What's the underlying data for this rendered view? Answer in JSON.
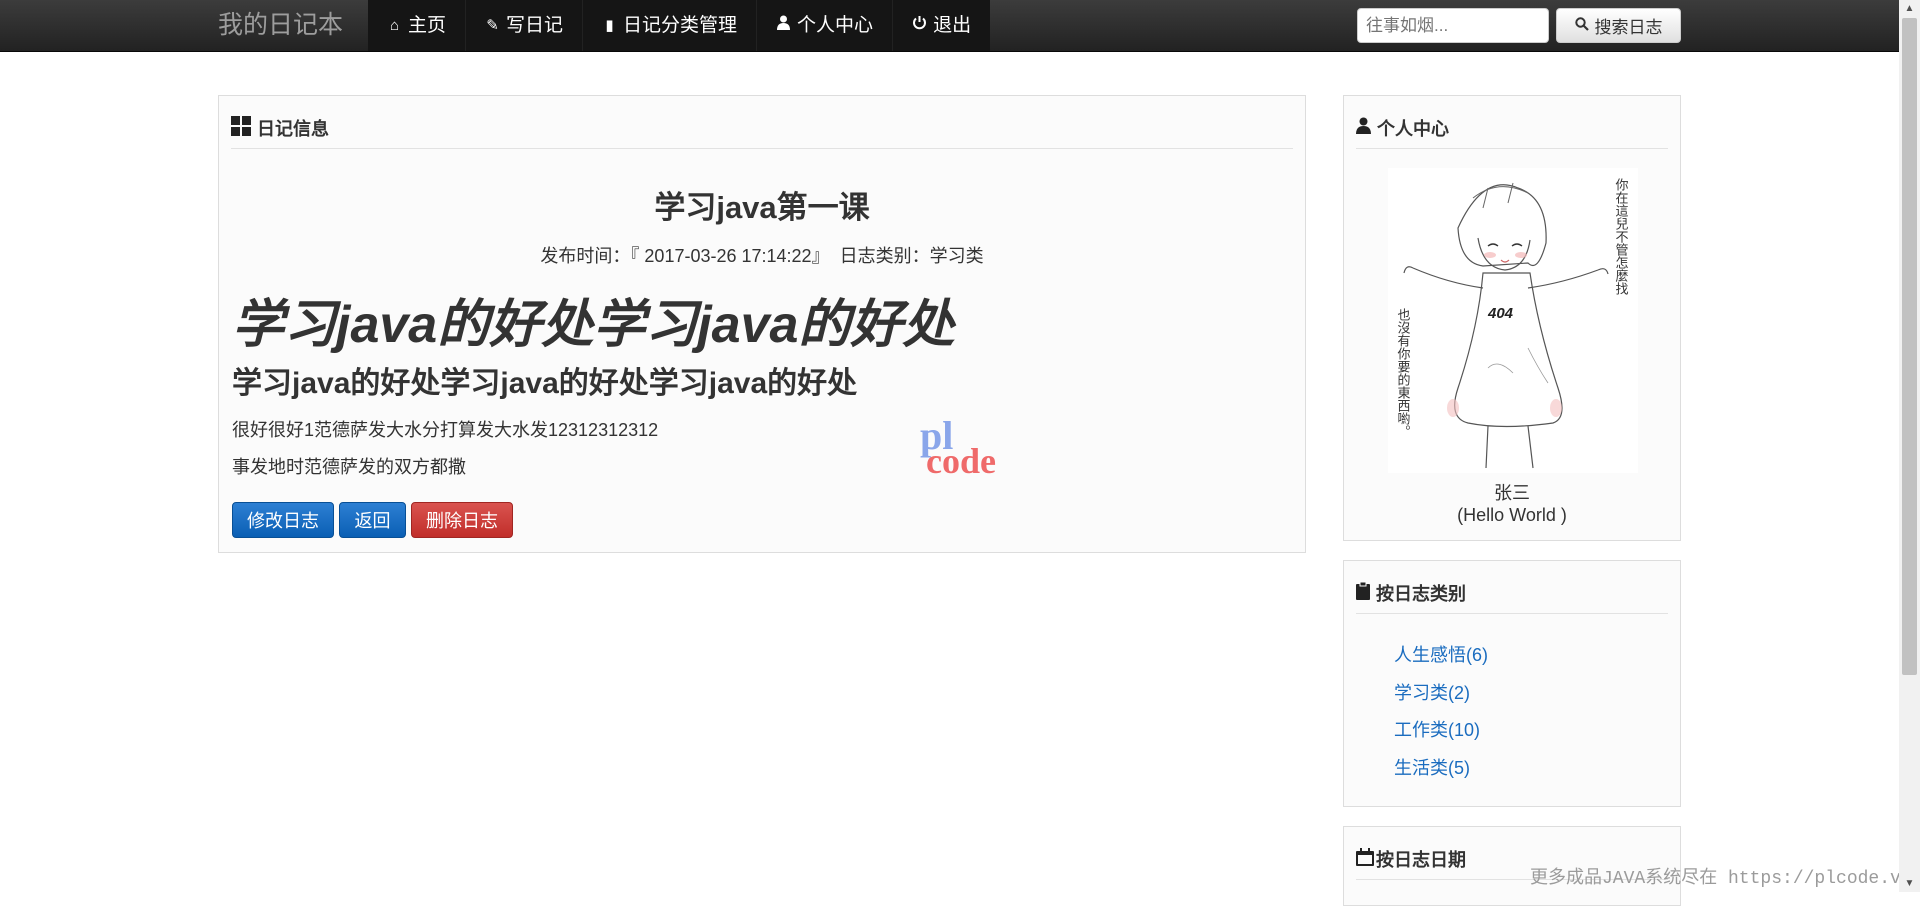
{
  "navbar": {
    "brand": "我的日记本",
    "items": [
      {
        "label": "主页",
        "icon": "home-icon",
        "glyph": "⌂"
      },
      {
        "label": "写日记",
        "icon": "pencil-icon",
        "glyph": "✎"
      },
      {
        "label": "日记分类管理",
        "icon": "book-icon",
        "glyph": "▮"
      },
      {
        "label": "个人中心",
        "icon": "user-icon",
        "glyph": "👤"
      },
      {
        "label": "退出",
        "icon": "power-icon",
        "glyph": "⏻"
      }
    ],
    "search_placeholder": "往事如烟...",
    "search_button": "搜索日志"
  },
  "main": {
    "heading": "日记信息",
    "title": "学习java第一课",
    "meta": "发布时间：『 2017-03-26 17:14:22』  日志类别：学习类",
    "content_h1": "学习java的好处学习java的好处",
    "content_h2": "学习java的好处学习java的好处学习java的好处",
    "paragraphs": [
      "很好很好1范德萨发大水分打算发大水发12312312312",
      "事发地时范德萨发的双方都撒"
    ],
    "buttons": {
      "edit": "修改日志",
      "back": "返回",
      "delete": "删除日志"
    },
    "watermark": {
      "top": "pl",
      "bottom": "code"
    }
  },
  "sidebar": {
    "user_panel": {
      "heading": "个人中心",
      "name": "张三",
      "motto": "(Hello World )",
      "avatar_text": [
        "你在這兒不管怎麼找",
        "也沒有你要的東西喲。"
      ],
      "avatar_badge": "404"
    },
    "category_panel": {
      "heading": "按日志类别",
      "items": [
        "人生感悟(6)",
        "学习类(2)",
        "工作类(10)",
        "生活类(5)"
      ]
    },
    "date_panel": {
      "heading": "按日志日期"
    }
  },
  "footer_watermark": "更多成品JAVA系统尽在 https://plcode.vi",
  "colors": {
    "navbar": "#222222",
    "link": "#1a6cbf",
    "primary": "#0a5fb4",
    "danger": "#d9534f"
  }
}
